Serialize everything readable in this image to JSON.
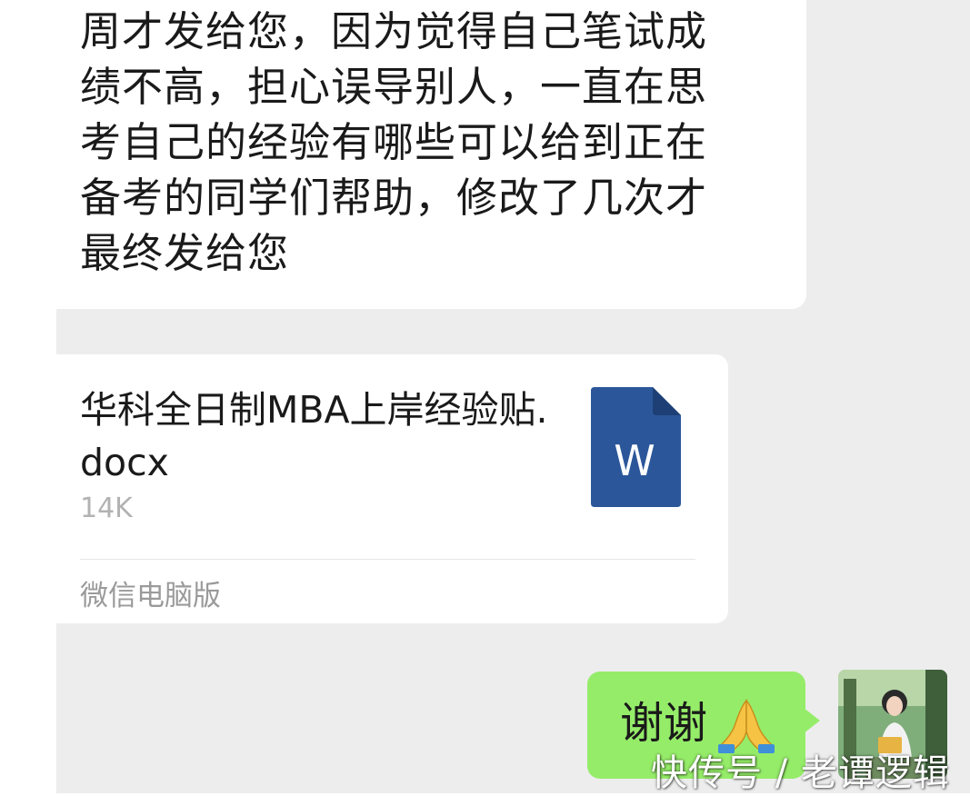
{
  "received_message": {
    "text": "周才发给您，因为觉得自己笔试成\n绩不高，担心误导别人，一直在思\n考自己的经验有哪些可以给到正在\n备考的同学们帮助，修改了几次才\n最终发给您"
  },
  "file_message": {
    "file_name": "华科全日制MBA上岸经验贴.docx",
    "file_size": "14K",
    "source_label": "微信电脑版",
    "file_icon": "word-doc-icon",
    "icon_letter": "W",
    "icon_color": "#2b579a"
  },
  "sent_message": {
    "text": "谢谢",
    "emoji": "folded-hands-icon",
    "bubble_color": "#95ec69"
  },
  "watermark": {
    "text": "快传号 / 老谭逻辑"
  },
  "colors": {
    "chat_background": "#ededed",
    "bubble_background": "#ffffff"
  }
}
